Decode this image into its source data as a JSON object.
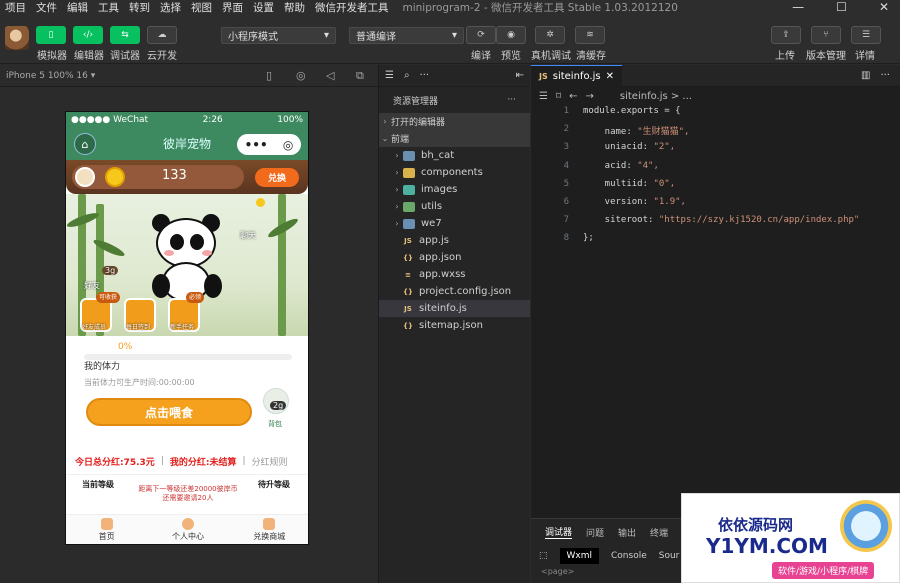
{
  "menu": {
    "items": [
      "项目",
      "文件",
      "编辑",
      "工具",
      "转到",
      "选择",
      "视图",
      "界面",
      "设置",
      "帮助",
      "微信开发者工具"
    ],
    "window_title": "miniprogram-2 - 微信开发者工具 Stable 1.03.2012120"
  },
  "window_controls": {
    "minimize": "—",
    "maximize": "☐",
    "close": "✕"
  },
  "toolbar": {
    "simulator": "模拟器",
    "editor": "编辑器",
    "debugger": "调试器",
    "cloud": "云开发",
    "mode": "小程序模式",
    "compile_mode": "普通编译",
    "compile": "编译",
    "preview": "预览",
    "real_debug": "真机调试",
    "clear_cache": "清缓存",
    "upload": "上传",
    "version": "版本管理",
    "details": "详情"
  },
  "simulator": {
    "device": "iPhone 5 100% 16 ▾"
  },
  "phone": {
    "status": {
      "carrier": "●●●●● WeChat",
      "time": "2:26",
      "battery": "100%"
    },
    "title": "彼岸宠物",
    "coins": "133",
    "exchange": "兑换",
    "scene": {
      "level_label": "3g",
      "friend_caption": "好友",
      "chat_caption": "聊天",
      "tools": [
        {
          "badge": "可收获",
          "label": "好友成员"
        },
        {
          "badge": "",
          "label": "每日签到"
        },
        {
          "badge": "必领",
          "label": "新手任务"
        }
      ]
    },
    "energy": {
      "percent": "0%",
      "title": "我的体力",
      "subtitle": "当前体力可生产时间:00:00:00",
      "feed_button": "点击喂食",
      "bag_count": "2g",
      "bag_caption": "背包"
    },
    "bonus": {
      "today": "今日总分红:75.3元",
      "mine": "我的分红:未结算",
      "rule": "分红规则"
    },
    "levels": {
      "current": "当前等级",
      "next": "待升等级",
      "note1": "距离下一等级还差20000彼岸币",
      "note2": "还需要邀请20人"
    },
    "tabs": [
      "首页",
      "个人中心",
      "兑换商城"
    ]
  },
  "explorer": {
    "title": "资源管理器",
    "open_editors": "打开的编辑器",
    "project": "前端",
    "items": [
      {
        "name": "bh_cat",
        "kind": "folder",
        "color": "#6a8fb0"
      },
      {
        "name": "components",
        "kind": "folder",
        "color": "#d8b24a"
      },
      {
        "name": "images",
        "kind": "folder",
        "color": "#4db0a0"
      },
      {
        "name": "utils",
        "kind": "folder",
        "color": "#6aa86a"
      },
      {
        "name": "we7",
        "kind": "folder",
        "color": "#6a8fb0"
      },
      {
        "name": "app.js",
        "kind": "file",
        "icon": "JS"
      },
      {
        "name": "app.json",
        "kind": "file",
        "icon": "{}"
      },
      {
        "name": "app.wxss",
        "kind": "file",
        "icon": "≡"
      },
      {
        "name": "project.config.json",
        "kind": "file",
        "icon": "{}"
      },
      {
        "name": "siteinfo.js",
        "kind": "file",
        "icon": "JS"
      },
      {
        "name": "sitemap.json",
        "kind": "file",
        "icon": "{}"
      }
    ]
  },
  "editor": {
    "tab": "siteinfo.js",
    "breadcrumb": "siteinfo.js > ...",
    "lines": [
      {
        "n": "1",
        "pre": "module.exports = {",
        "val": ""
      },
      {
        "n": "2",
        "pre": "    name: ",
        "val": "\"生财猫猫\","
      },
      {
        "n": "3",
        "pre": "    uniacid: ",
        "val": "\"2\","
      },
      {
        "n": "4",
        "pre": "    acid: ",
        "val": "\"4\","
      },
      {
        "n": "5",
        "pre": "    multiid: ",
        "val": "\"0\","
      },
      {
        "n": "6",
        "pre": "    version: ",
        "val": "\"1.9\","
      },
      {
        "n": "7",
        "pre": "    siteroot: ",
        "val": "\"https://szy.kj1520.cn/app/index.php\""
      },
      {
        "n": "8",
        "pre": "};",
        "val": ""
      }
    ]
  },
  "panel": {
    "tabs": [
      "调试器",
      "问题",
      "输出",
      "终端"
    ],
    "subtabs": [
      "Wxml",
      "Console",
      "Sour"
    ],
    "bottom_text": "<page>"
  },
  "watermark": {
    "line1": "依依源码网",
    "line2": "Y1YM.COM",
    "line3": "软件/游戏/小程序/棋牌"
  }
}
